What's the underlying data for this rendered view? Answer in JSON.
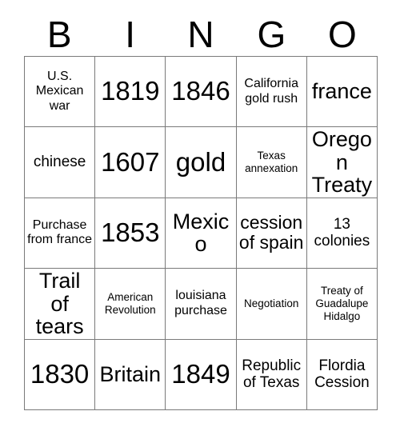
{
  "card": {
    "title": "BINGO",
    "headers": [
      "B",
      "I",
      "N",
      "G",
      "O"
    ],
    "rows": [
      [
        {
          "text": "U.S. Mexican war",
          "size": "sm"
        },
        {
          "text": "1819",
          "size": "xxl"
        },
        {
          "text": "1846",
          "size": "xxl"
        },
        {
          "text": "California gold rush",
          "size": "sm"
        },
        {
          "text": "france",
          "size": "xl"
        }
      ],
      [
        {
          "text": "chinese",
          "size": "md"
        },
        {
          "text": "1607",
          "size": "xxl"
        },
        {
          "text": "gold",
          "size": "xxl"
        },
        {
          "text": "Texas annexation",
          "size": "xs"
        },
        {
          "text": "Oregon Treaty",
          "size": "xl"
        }
      ],
      [
        {
          "text": "Purchase from france",
          "size": "sm"
        },
        {
          "text": "1853",
          "size": "xxl"
        },
        {
          "text": "Mexico",
          "size": "xl"
        },
        {
          "text": "cession of spain",
          "size": "lg"
        },
        {
          "text": "13 colonies",
          "size": "md"
        }
      ],
      [
        {
          "text": "Trail of tears",
          "size": "xl"
        },
        {
          "text": "American Revolution",
          "size": "xs"
        },
        {
          "text": "louisiana purchase",
          "size": "sm"
        },
        {
          "text": "Negotiation",
          "size": "xs"
        },
        {
          "text": "Treaty of Guadalupe Hidalgo",
          "size": "xs"
        }
      ],
      [
        {
          "text": "1830",
          "size": "xxl"
        },
        {
          "text": "Britain",
          "size": "xl"
        },
        {
          "text": "1849",
          "size": "xxl"
        },
        {
          "text": "Republic of Texas",
          "size": "md"
        },
        {
          "text": "Flordia Cession",
          "size": "md"
        }
      ]
    ]
  },
  "colors": {
    "background": "#ffffff",
    "text": "#000000",
    "grid_line": "#7a7a7a"
  }
}
